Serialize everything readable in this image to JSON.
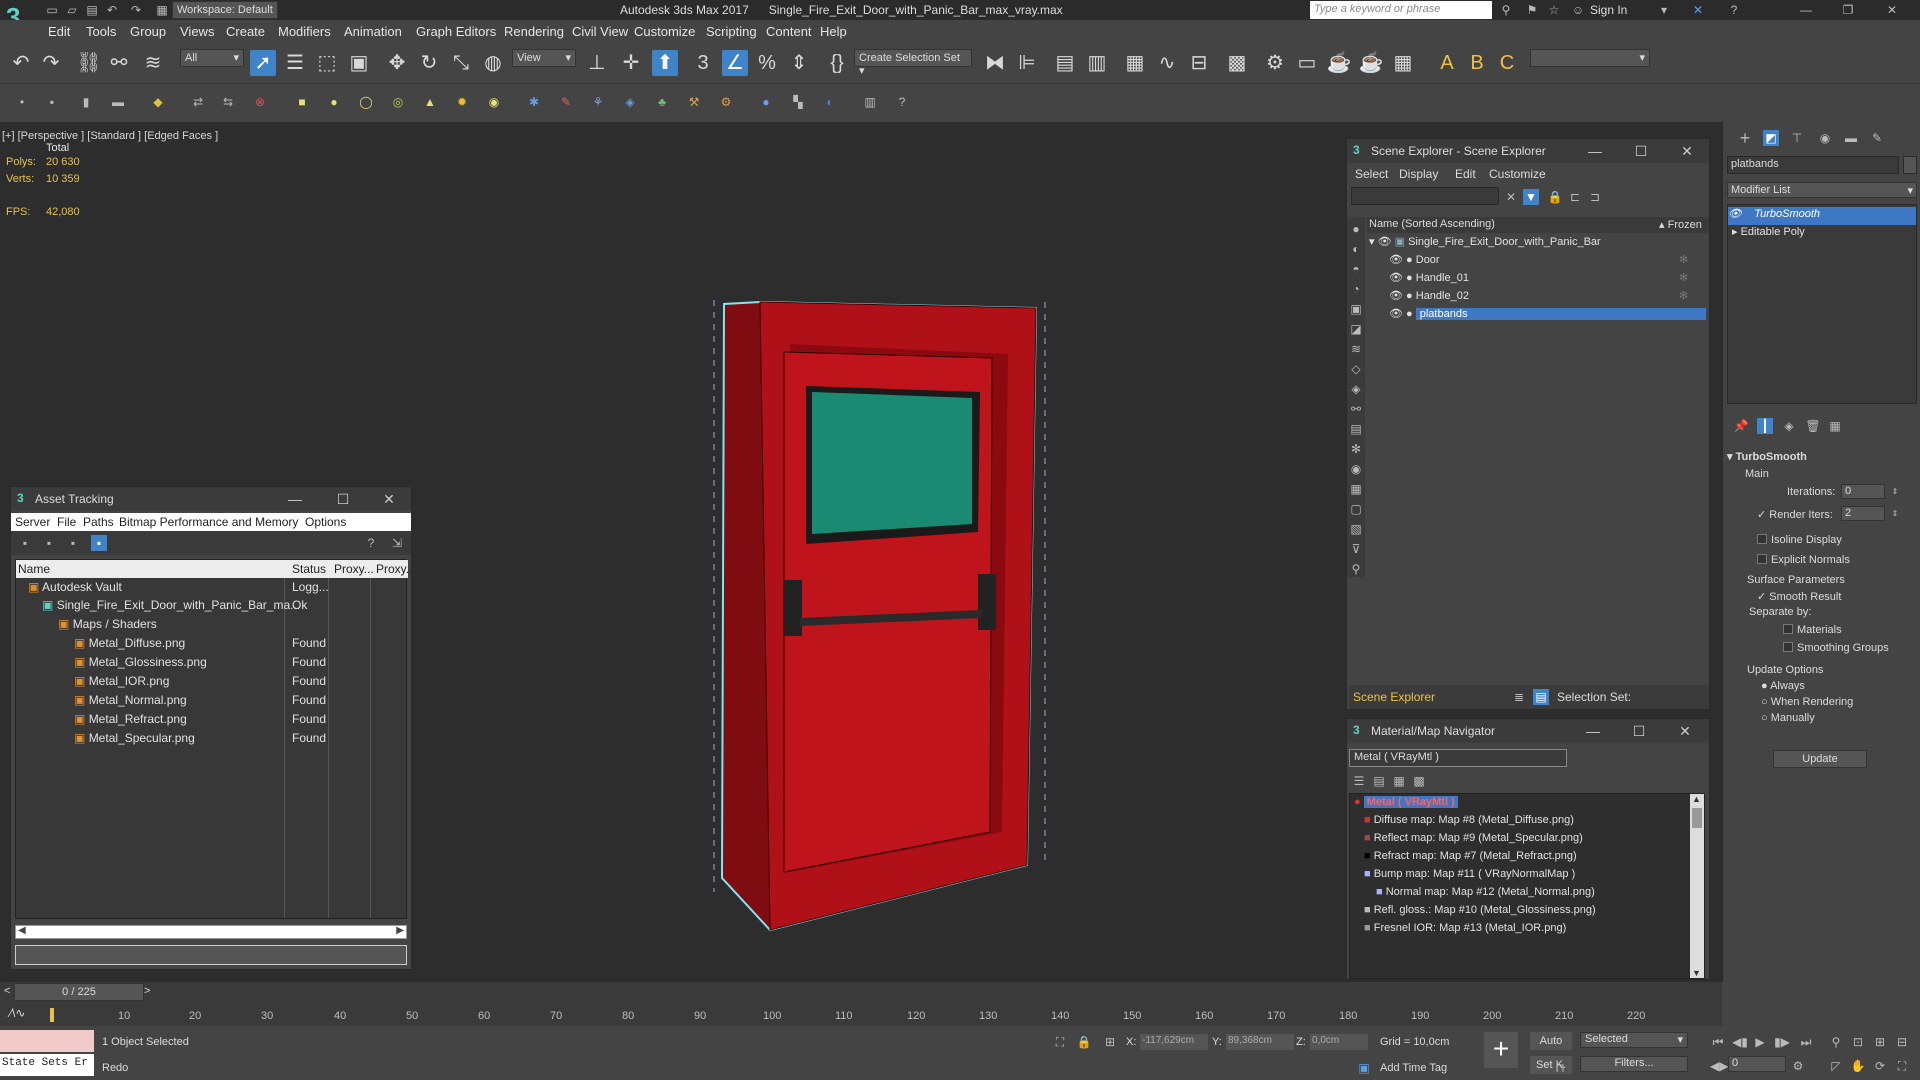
{
  "title_bar": {
    "workspace": "Workspace: Default",
    "app_title": "Autodesk 3ds Max 2017",
    "file_title": "Single_Fire_Exit_Door_with_Panic_Bar_max_vray.max",
    "search_placeholder": "Type a keyword or phrase",
    "sign_in": "Sign In"
  },
  "menu": [
    "Edit",
    "Tools",
    "Group",
    "Views",
    "Create",
    "Modifiers",
    "Animation",
    "Graph Editors",
    "Rendering",
    "Civil View",
    "Customize",
    "Scripting",
    "Content",
    "Help"
  ],
  "toolbar": {
    "filter_value": "All",
    "view_value": "View",
    "selection_set": "Create Selection Set"
  },
  "viewport": {
    "label": "[+] [Perspective ] [Standard ] [Edged Faces ]",
    "total": "Total",
    "polys_label": "Polys:",
    "polys_value": "20 630",
    "verts_label": "Verts:",
    "verts_value": "10 359",
    "fps_label": "FPS:",
    "fps_value": "42,080",
    "colors": {
      "door": "#c0141c",
      "glass": "#1a8a72",
      "select_outline": "#7fe7f2"
    }
  },
  "asset_tracking": {
    "title": "Asset Tracking",
    "menu": [
      "Server",
      "File",
      "Paths",
      "Bitmap Performance and Memory",
      "Options"
    ],
    "columns": [
      "Name",
      "Status",
      "Proxy...",
      "Proxy..."
    ],
    "rows": [
      {
        "name": "Autodesk Vault",
        "status": "Logg..."
      },
      {
        "name": "Single_Fire_Exit_Door_with_Panic_Bar_ma...",
        "status": "Ok"
      },
      {
        "name": "Maps / Shaders",
        "status": ""
      },
      {
        "name": "Metal_Diffuse.png",
        "status": "Found"
      },
      {
        "name": "Metal_Glossiness.png",
        "status": "Found"
      },
      {
        "name": "Metal_IOR.png",
        "status": "Found"
      },
      {
        "name": "Metal_Normal.png",
        "status": "Found"
      },
      {
        "name": "Metal_Refract.png",
        "status": "Found"
      },
      {
        "name": "Metal_Specular.png",
        "status": "Found"
      }
    ]
  },
  "scene_explorer": {
    "title": "Scene Explorer - Scene Explorer",
    "menu": [
      "Select",
      "Display",
      "Edit",
      "Customize"
    ],
    "col_name": "Name (Sorted Ascending)",
    "col_frozen": "Frozen",
    "root": "Single_Fire_Exit_Door_with_Panic_Bar",
    "items": [
      "Door",
      "Handle_01",
      "Handle_02",
      "platbands"
    ],
    "footer_label": "Scene Explorer",
    "selection_set_label": "Selection Set:"
  },
  "material_navigator": {
    "title": "Material/Map Navigator",
    "field_value": "Metal  ( VRayMtl )",
    "root": "Metal  ( VRayMtl )",
    "items": [
      "Diffuse map: Map #8 (Metal_Diffuse.png)",
      "Reflect map: Map #9 (Metal_Specular.png)",
      "Refract map: Map #7 (Metal_Refract.png)",
      "Bump map: Map #11  ( VRayNormalMap )",
      "Normal map: Map #12 (Metal_Normal.png)",
      "Refl. gloss.: Map #10 (Metal_Glossiness.png)",
      "Fresnel IOR: Map #13 (Metal_IOR.png)"
    ]
  },
  "command_panel": {
    "object_name": "platbands",
    "modifier_list": "Modifier List",
    "stack": [
      "TurboSmooth",
      "Editable Poly"
    ],
    "rollout_title": "TurboSmooth",
    "main_label": "Main",
    "iterations_label": "Iterations:",
    "iterations_value": "0",
    "render_iters_label": "Render Iters:",
    "render_iters_value": "2",
    "isoline": "Isoline Display",
    "explicit": "Explicit Normals",
    "surface_params": "Surface Parameters",
    "smooth_result": "Smooth Result",
    "separate_by": "Separate by:",
    "materials": "Materials",
    "smoothing_groups": "Smoothing Groups",
    "update_options": "Update Options",
    "always": "Always",
    "when_rendering": "When Rendering",
    "manually": "Manually",
    "update_btn": "Update"
  },
  "timeline": {
    "frame": "0 / 225",
    "ticks": [
      "10",
      "20",
      "30",
      "40",
      "50",
      "60",
      "70",
      "80",
      "90",
      "100",
      "110",
      "120",
      "130",
      "140",
      "150",
      "160",
      "170",
      "180",
      "190",
      "200",
      "210",
      "220"
    ]
  },
  "status": {
    "maxscript": "State Sets Er",
    "selected": "1 Object Selected",
    "prompt": "Redo",
    "x_label": "X:",
    "x_value": "-117,629cm",
    "y_label": "Y:",
    "y_value": "89,368cm",
    "z_label": "Z:",
    "z_value": "0,0cm",
    "grid": "Grid = 10,0cm",
    "add_time_tag": "Add Time Tag",
    "auto": "Auto",
    "set_k": "Set K.",
    "selected_dd": "Selected",
    "filters": "Filters...",
    "frame_field": "0"
  }
}
